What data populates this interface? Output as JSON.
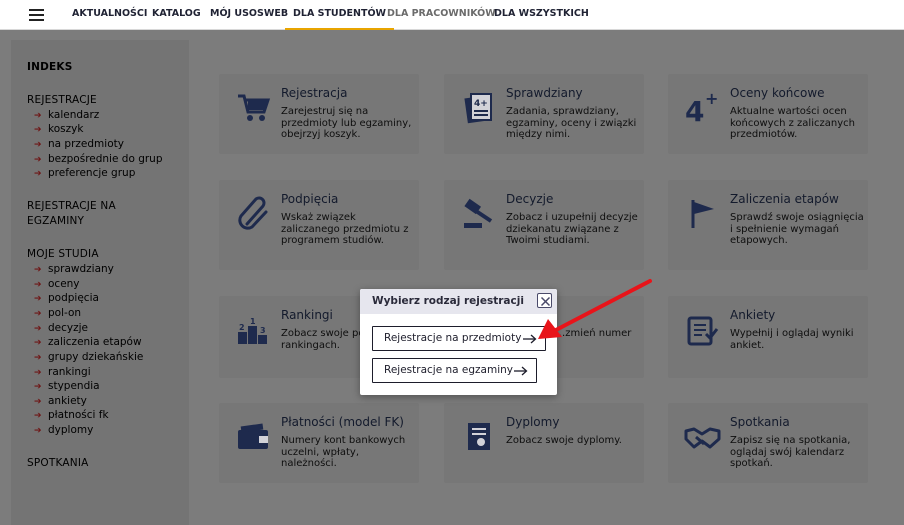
{
  "nav": {
    "tabs": [
      {
        "label": "AKTUALNOŚCI"
      },
      {
        "label": "KATALOG"
      },
      {
        "label": "MÓJ USOSWEB"
      },
      {
        "label": "DLA STUDENTÓW"
      },
      {
        "label": "DLA PRACOWNIKÓW"
      },
      {
        "label": "DLA WSZYSTKICH"
      }
    ],
    "active_tab": "DLA STUDENTÓW",
    "accent_color": "#e8a400"
  },
  "sidebar": {
    "index_label": "INDEKS",
    "rejestracje_label": "REJESTRACJE",
    "rejestracje_items": [
      "kalendarz",
      "koszyk",
      "na przedmioty",
      "bezpośrednie do grup",
      "preferencje grup"
    ],
    "rejestracje_egzaminy_line1": "REJESTRACJE NA",
    "rejestracje_egzaminy_line2": "EGZAMINY",
    "moje_studia_label": "MOJE STUDIA",
    "moje_studia_items": [
      "sprawdziany",
      "oceny",
      "podpięcia",
      "pol-on",
      "decyzje",
      "zaliczenia etapów",
      "grupy dziekańskie",
      "rankingi",
      "stypendia",
      "ankiety",
      "płatności fk",
      "dyplomy"
    ],
    "spotkania_label": "SPOTKANIA"
  },
  "cards": [
    {
      "title": "Rejestracja",
      "desc": "Zarejestruj się na przedmioty lub egzaminy, obejrzyj koszyk.",
      "icon": "cart-icon"
    },
    {
      "title": "Sprawdziany",
      "desc": "Zadania, sprawdziany, egzaminy, oceny i związki między nimi.",
      "icon": "test-sheet-icon"
    },
    {
      "title": "Oceny końcowe",
      "desc": "Aktualne wartości ocen końcowych z zaliczanych przedmiotów.",
      "icon": "grade-four-plus-icon"
    },
    {
      "title": "Podpięcia",
      "desc": "Wskaż związek zaliczanego przedmiotu z programem studiów.",
      "icon": "paperclip-icon"
    },
    {
      "title": "Decyzje",
      "desc": "Zobacz i uzupełnij decyzje dziekanatu związane z Twoimi studiami.",
      "icon": "gavel-icon"
    },
    {
      "title": "Zaliczenia etapów",
      "desc": "Sprawdź swoje osiągnięcia i spełnienie wymagań etapowych.",
      "icon": "flag-icon"
    },
    {
      "title": "Rankingi",
      "desc": "Zobacz swoje pozycje w rankingach.",
      "icon": "podium-icon"
    },
    {
      "title": "",
      "desc": "…yznane …zmień numer",
      "icon": "hidden-icon"
    },
    {
      "title": "Ankiety",
      "desc": "Wypełnij i oglądaj wyniki ankiet.",
      "icon": "survey-icon"
    },
    {
      "title": "Płatności (model FK)",
      "desc": "Numery kont bankowych uczelni, wpłaty, należności.",
      "icon": "wallet-icon"
    },
    {
      "title": "Dyplomy",
      "desc": "Zobacz swoje dyplomy.",
      "icon": "diploma-icon"
    },
    {
      "title": "Spotkania",
      "desc": "Zapisz się na spotkania, oglądaj swój kalendarz spotkań.",
      "icon": "handshake-icon"
    }
  ],
  "modal": {
    "title": "Wybierz rodzaj rejestracji",
    "btn_przedmioty": "Rejestracje na przedmioty",
    "btn_egzaminy": "Rejestracje na egzaminy"
  },
  "annotation": {
    "color": "#e8141a"
  }
}
